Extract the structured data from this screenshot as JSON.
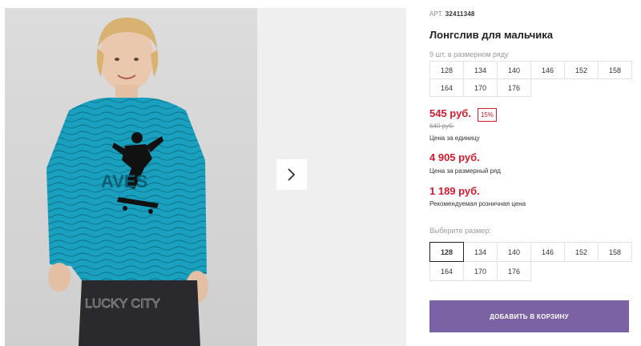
{
  "gallery": {
    "photo_print_text": "AVES",
    "jeans_text": "LUCKY CITY",
    "next_icon": "chevron-right-icon"
  },
  "product": {
    "art_label": "АРТ.",
    "art_number": "32411348",
    "title": "Лонгслив для мальчика",
    "range_caption": "9 шт. в размерном ряду",
    "range_sizes": [
      "128",
      "134",
      "140",
      "146",
      "152",
      "158",
      "164",
      "170",
      "176"
    ]
  },
  "pricing": {
    "price": "545 руб.",
    "discount": "15%",
    "old_price": "640 руб.",
    "unit_label": "Цена за единицу",
    "range_price": "4 905 руб.",
    "range_price_label": "Цена за размерный ряд",
    "retail_price": "1 189 руб.",
    "retail_price_label": "Рекомендуемая розничная цена"
  },
  "size_select": {
    "label": "Выберите размер:",
    "selected": "128",
    "options": [
      "128",
      "134",
      "140",
      "146",
      "152",
      "158",
      "164",
      "170",
      "176"
    ]
  },
  "cart": {
    "button_label": "ДОБАВИТЬ В КОРЗИНУ",
    "color": "#7b62a4"
  },
  "colors": {
    "price_red": "#d31b2d",
    "shirt_teal": "#1aa0bf"
  }
}
